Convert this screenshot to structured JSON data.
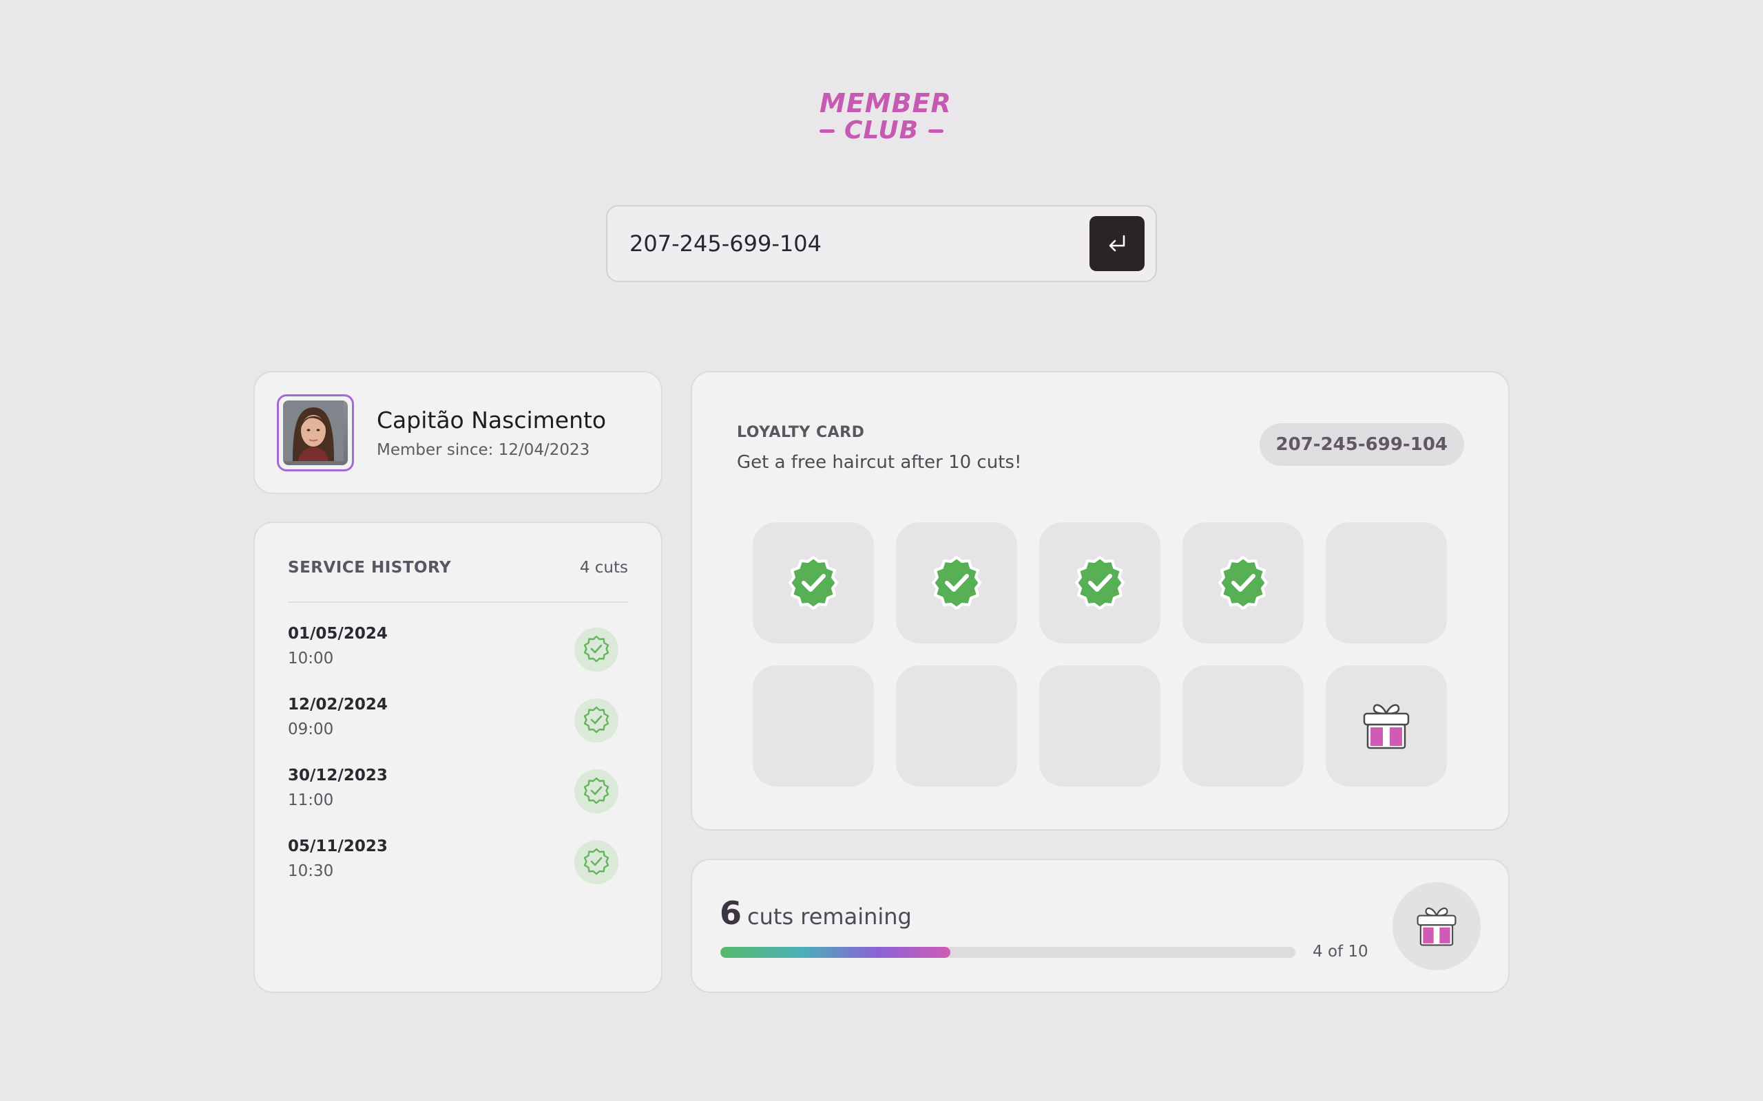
{
  "logo": {
    "line1": "MEMBER",
    "line2": "CLUB"
  },
  "search": {
    "value": "207-245-699-104",
    "submit_icon": "enter-icon"
  },
  "profile": {
    "name": "Capitão Nascimento",
    "member_since": "Member since: 12/04/2023",
    "avatar": "avatar-photo"
  },
  "history": {
    "title": "SERVICE HISTORY",
    "count": "4 cuts",
    "rows": [
      {
        "date": "01/05/2024",
        "time": "10:00"
      },
      {
        "date": "12/02/2024",
        "time": "09:00"
      },
      {
        "date": "30/12/2023",
        "time": "11:00"
      },
      {
        "date": "05/11/2023",
        "time": "10:30"
      }
    ],
    "row_icon": "check-badge-icon"
  },
  "loyalty": {
    "title": "LOYALTY CARD",
    "subtitle": "Get a free haircut after 10 cuts!",
    "card_id": "207-245-699-104",
    "total_slots": 10,
    "stamped": 4,
    "reward_icon": "gift-icon"
  },
  "progress": {
    "remaining_number": "6",
    "remaining_text": "cuts remaining",
    "ratio_text": "4 of 10",
    "fraction": 0.4
  },
  "colors": {
    "accent": "#c55ab0",
    "stamp_green": "#58b055",
    "avatar_border": "#a667d8",
    "background": "#e9e7ea"
  }
}
